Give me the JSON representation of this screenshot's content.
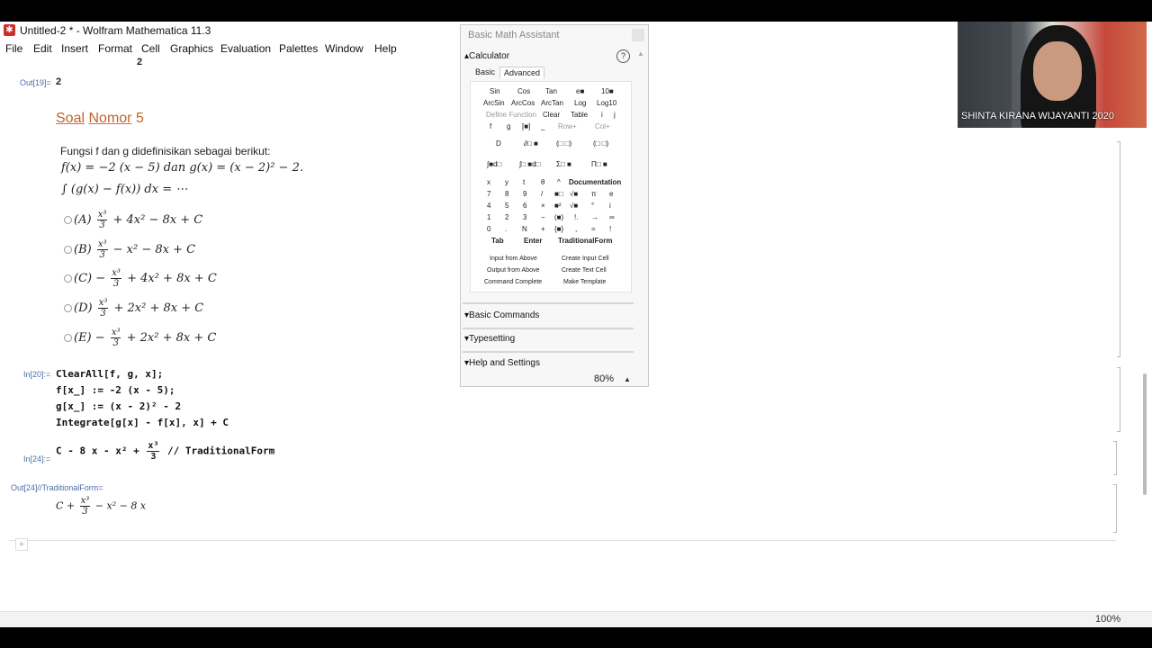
{
  "window": {
    "title": "Untitled-2 * - Wolfram Mathematica 11.3",
    "app_icon": "wolfram-icon"
  },
  "menu": [
    "File",
    "Edit",
    "Insert",
    "Format",
    "Cell",
    "Graphics",
    "Evaluation",
    "Palettes",
    "Window",
    "Help"
  ],
  "notebook": {
    "prev_output": "2",
    "out19_label": "Out[19]=",
    "out19_value": "2",
    "section_title_a": "Soal",
    "section_title_b": "Nomor",
    "section_title_c": "5",
    "problem_intro": "Fungsi f dan g didefinisikan sebagai berikut:",
    "problem_def": "f(x) = −2 (x − 5) dan g(x) = (x − 2)² − 2.",
    "integral": "∫ (g(x) − f(x)) dx = ⋯",
    "options": [
      {
        "label": "(A)",
        "sign": "",
        "rest": "+ 4x² − 8x + C"
      },
      {
        "label": "(B)",
        "sign": "",
        "rest": "− x² − 8x + C"
      },
      {
        "label": "(C)",
        "sign": "−",
        "rest": "+ 4x² + 8x + C"
      },
      {
        "label": "(D)",
        "sign": "",
        "rest": "+ 2x² + 8x + C"
      },
      {
        "label": "(E)",
        "sign": "−",
        "rest": "+ 2x² + 8x + C"
      }
    ],
    "frac_num": "x³",
    "frac_den": "3",
    "in20_label": "In[20]:=",
    "in20_lines": [
      "ClearAll[f, g, x];",
      "f[x_] := -2 (x - 5);",
      "g[x_] := (x - 2)² - 2",
      "Integrate[g[x] - f[x], x] + C"
    ],
    "in24_label": "In[24]:=",
    "in24_pre": "C - 8 x - x² +",
    "in24_post": "// TraditionalForm",
    "out24_label": "Out[24]//TraditionalForm=",
    "out24_pre": "C +",
    "out24_post": "− x² − 8 x",
    "zoom": "100%"
  },
  "palette": {
    "title": "Basic Math Assistant",
    "calculator": "Calculator",
    "tabs": [
      "Basic",
      "Advanced"
    ],
    "row1": [
      "Sin",
      "Cos",
      "Tan",
      "e■",
      "10■"
    ],
    "row2": [
      "ArcSin",
      "ArcCos",
      "ArcTan",
      "Log",
      "Log10"
    ],
    "row3": [
      "Define Function",
      "Clear",
      "Table",
      "i",
      "j"
    ],
    "row4": [
      "f",
      "g",
      "[■]",
      "_",
      "Row+",
      "Col+"
    ],
    "row5": [
      "D",
      "∂□ ■",
      "(□ □)",
      "(□ □)"
    ],
    "row6": [
      "∫■d□",
      "∫□ ■d□",
      "Σ□ ■",
      "Π□ ■"
    ],
    "row7": [
      "x",
      "y",
      "t",
      "θ",
      "^",
      "Documentation"
    ],
    "row8": [
      "7",
      "8",
      "9",
      "/",
      "■□",
      "√■",
      "π",
      "e"
    ],
    "row9": [
      "4",
      "5",
      "6",
      "×",
      "■²",
      "√■",
      "°",
      "i"
    ],
    "row10": [
      "1",
      "2",
      "3",
      "−",
      "(■)",
      "!.",
      "→",
      "∞"
    ],
    "row11": [
      "0",
      ".",
      "N",
      "+",
      "{■}",
      ",",
      "=",
      "!"
    ],
    "row12": [
      "Tab",
      "Enter",
      "TraditionalForm"
    ],
    "row13": [
      "Input from Above",
      "Create Input Cell"
    ],
    "row14": [
      "Output from Above",
      "Create Text Cell"
    ],
    "row15": [
      "Command Complete",
      "Make Template"
    ],
    "basic_commands": "Basic Commands",
    "typesetting": "Typesetting",
    "help_settings": "Help and Settings",
    "zoom": "80%"
  },
  "webcam": {
    "name": "SHINTA KIRANA WIJAYANTI 2020"
  }
}
